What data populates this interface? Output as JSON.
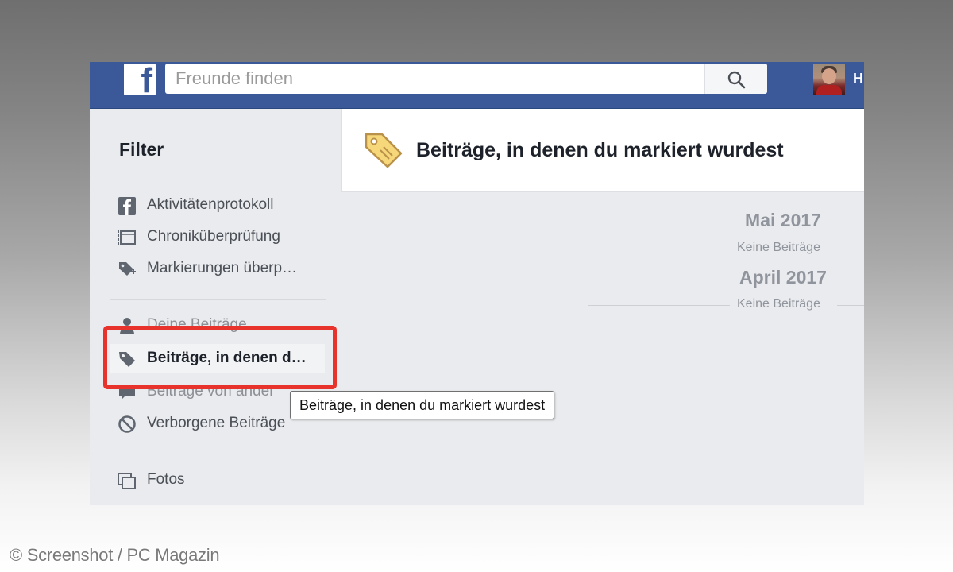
{
  "header": {
    "logo": "f",
    "search_placeholder": "Freunde finden",
    "user_initial": "H"
  },
  "sidebar": {
    "title": "Filter",
    "items": [
      {
        "label": "Aktivitätenprotokoll",
        "icon": "facebook-square-icon"
      },
      {
        "label": "Chroniküberprüfung",
        "icon": "timeline-review-icon"
      },
      {
        "label": "Markierungen überp…",
        "icon": "tag-plus-icon"
      },
      {
        "label": "Deine Beiträge",
        "icon": "person-icon"
      },
      {
        "label": "Beiträge, in denen d…",
        "icon": "tag-icon",
        "active": true
      },
      {
        "label": "Beiträge von ander",
        "icon": "speech-bubble-icon"
      },
      {
        "label": "Verborgene Beiträge",
        "icon": "prohibited-icon"
      },
      {
        "label": "Fotos",
        "icon": "photos-icon"
      }
    ]
  },
  "main": {
    "title": "Beiträge, in denen du markiert wurdest",
    "months": [
      {
        "name": "Mai 2017",
        "status": "Keine Beiträge"
      },
      {
        "name": "April 2017",
        "status": "Keine Beiträge"
      }
    ]
  },
  "tooltip": "Beiträge, in denen du markiert wurdest",
  "credit": "© Screenshot / PC Magazin",
  "colors": {
    "facebook_blue": "#3b5998",
    "highlight_red": "#e8322c",
    "page_bg": "#e9ebee"
  }
}
